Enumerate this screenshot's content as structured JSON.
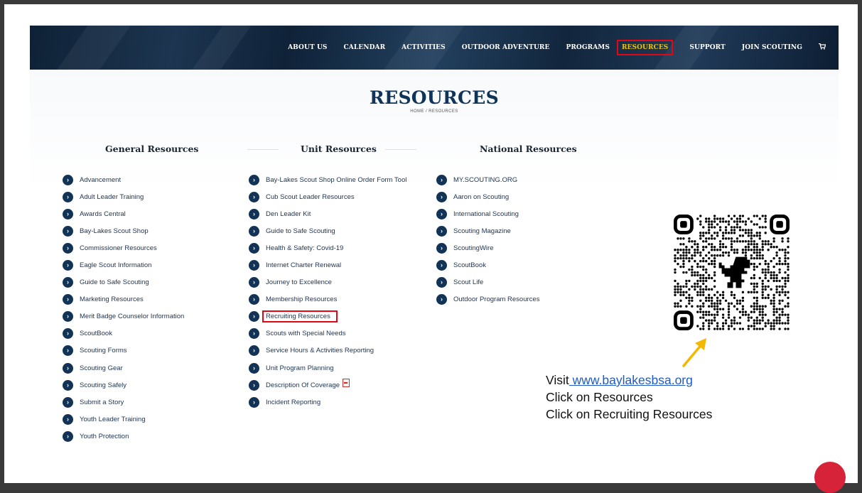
{
  "nav": {
    "items": [
      "ABOUT US",
      "CALENDAR",
      "ACTIVITIES",
      "OUTDOOR ADVENTURE",
      "PROGRAMS"
    ],
    "active": "RESOURCES",
    "after": [
      "SUPPORT",
      "JOIN SCOUTING"
    ],
    "cart_icon": "cart-icon"
  },
  "page": {
    "title": "RESOURCES",
    "breadcrumb": "HOME / RESOURCES"
  },
  "columns": {
    "general": {
      "heading": "General Resources",
      "items": [
        "Advancement",
        "Adult Leader Training",
        "Awards Central",
        "Bay-Lakes Scout Shop",
        "Commissioner Resources",
        "Eagle Scout Information",
        "Guide to Safe Scouting",
        "Marketing Resources",
        "Merit Badge Counselor Information",
        "ScoutBook",
        "Scouting Forms",
        "Scouting Gear",
        "Scouting Safely",
        "Submit a Story",
        "Youth Leader Training",
        "Youth Protection"
      ]
    },
    "unit": {
      "heading": "Unit Resources",
      "items": [
        "Bay-Lakes Scout Shop Online Order Form Tool",
        "Cub Scout Leader Resources",
        "Den Leader Kit",
        "Guide to Safe Scouting",
        "Health & Safety: Covid-19",
        "Internet Charter Renewal",
        "Journey to Excellence",
        "Membership Resources",
        "Recruiting Resources",
        "Scouts with Special Needs",
        "Service Hours & Activities Reporting",
        "Unit Program Planning",
        "Description Of Coverage",
        "Incident Reporting"
      ],
      "highlighted": "Recruiting Resources"
    },
    "national": {
      "heading": "National Resources",
      "items": [
        "MY.SCOUTING.ORG",
        "Aaron on Scouting",
        "International Scouting",
        "Scouting Magazine",
        "ScoutingWire",
        "ScoutBook",
        "Scout Life",
        "Outdoor Program Resources"
      ]
    }
  },
  "instructions": {
    "visit_prefix": "Visit",
    "url": " www.baylakesbsa.org",
    "line2": "Click on Resources",
    "line3": "Click on Recruiting Resources"
  },
  "colors": {
    "navy": "#123356",
    "highlight": "#e30613",
    "active_nav_text": "#f2c200",
    "arrow": "#f5b800",
    "link": "#1f5bc6"
  },
  "icons": {
    "bullet": "chevron-right-circle-icon",
    "qr": "qr-code-icon",
    "arrow": "arrow-icon",
    "pdf": "pdf-icon"
  }
}
